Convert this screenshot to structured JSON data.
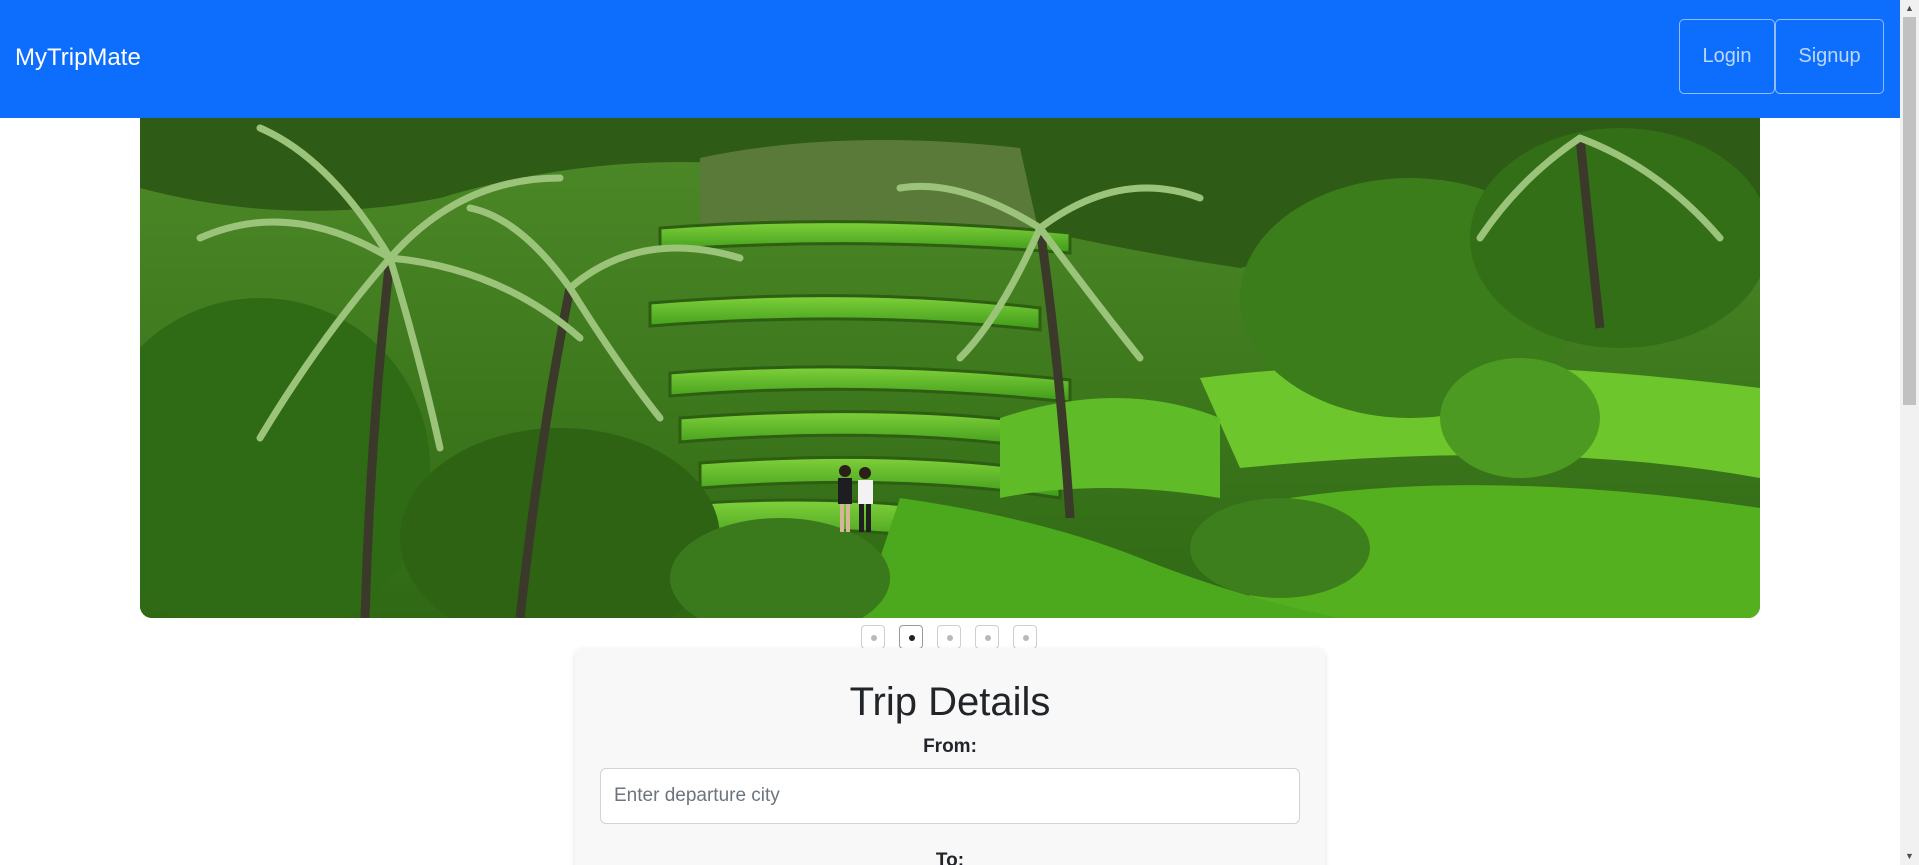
{
  "navbar": {
    "brand": "MyTripMate",
    "login_label": "Login",
    "signup_label": "Signup",
    "background_color": "#0d6efd"
  },
  "carousel": {
    "slide_count": 5,
    "active_index": 1,
    "image_subject": "rice terraces with palm trees"
  },
  "trip_form": {
    "title": "Trip Details",
    "from_label": "From:",
    "from_placeholder": "Enter departure city",
    "from_value": "",
    "to_label": "To:"
  },
  "scrollbar": {
    "up_icon": "chevron-up-icon",
    "down_icon": "chevron-down-icon"
  }
}
